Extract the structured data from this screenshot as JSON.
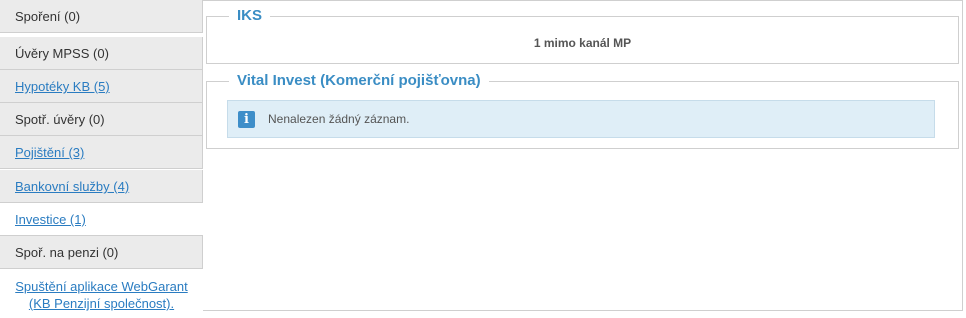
{
  "sidebar": {
    "items": [
      {
        "label": "Spoření (0)",
        "linked": false,
        "active": false
      },
      {
        "label": "Úvěry MPSS (0)",
        "linked": false,
        "active": false
      },
      {
        "label": "Hypotéky KB (5)",
        "linked": true,
        "active": false
      },
      {
        "label": "Spotř. úvěry (0)",
        "linked": false,
        "active": false
      },
      {
        "label": "Pojištění (3)",
        "linked": true,
        "active": false
      },
      {
        "label": "Bankovní služby (4)",
        "linked": true,
        "active": false
      },
      {
        "label": "Investice (1)",
        "linked": true,
        "active": true
      },
      {
        "label": "Spoř. na penzi (0)",
        "linked": false,
        "active": false
      }
    ],
    "footer_link_line1": "Spuštění aplikace WebGarant",
    "footer_link_line2": "(KB Penzijní společnost)."
  },
  "main": {
    "iks": {
      "title": "IKS",
      "value": "1 mimo kanál MP"
    },
    "vital": {
      "title": "Vital Invest (Komerční pojišťovna)",
      "info_icon": "info-icon",
      "message": "Nenalezen žádný záznam."
    }
  }
}
